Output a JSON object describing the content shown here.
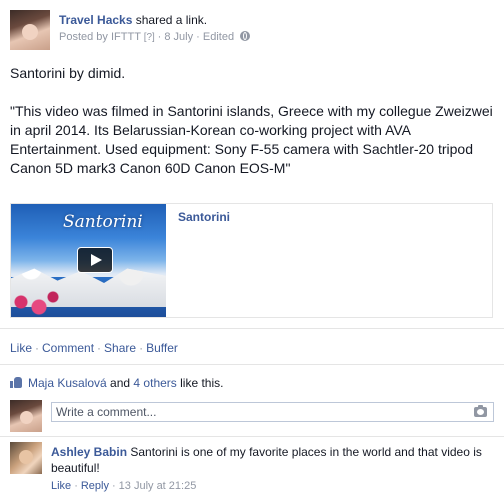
{
  "post": {
    "author": "Travel Hacks",
    "shared_text": " shared a link.",
    "posted_by_prefix": "Posted by ",
    "posted_by": "IFTTT",
    "bracket": " [?] ",
    "date": "8 July",
    "edited": "Edited",
    "icon": "globe-icon",
    "message_line1": "Santorini by dimid.",
    "message_line2": "\"This video was filmed in Santorini islands, Greece with my collegue Zweizwei in april 2014. Its Belarussian-Korean co-working project with AVA Entertainment. Used equipment: Sony F-55 camera with Sachtler-20 tripod Canon 5D mark3 Canon 60D Canon EOS-M\""
  },
  "attachment": {
    "thumbnail_title": "Santorini",
    "title": "Santorini"
  },
  "actions": {
    "like": "Like",
    "comment": "Comment",
    "share": "Share",
    "buffer": "Buffer",
    "separator": "·"
  },
  "likes": {
    "name": "Maja Kusalová",
    "and": " and ",
    "others": "4 others",
    "suffix": " like this."
  },
  "comment_box": {
    "placeholder": "Write a comment..."
  },
  "comment": {
    "name": "Ashley Babin",
    "text": " Santorini is one of my favorite places in the world and that video is beautiful!",
    "like": "Like",
    "reply": "Reply",
    "time": "13 July at 21:25"
  },
  "colors": {
    "link": "#3b5998",
    "meta": "#9197a3"
  }
}
